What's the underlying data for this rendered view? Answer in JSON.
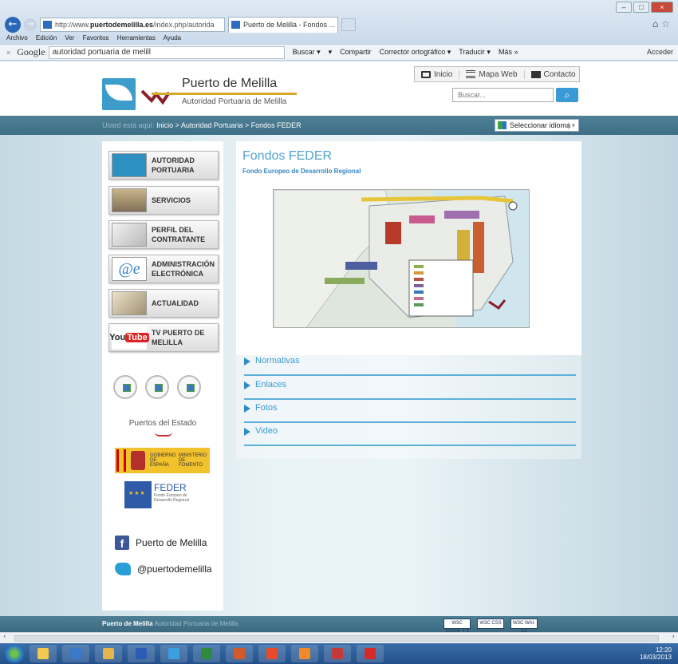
{
  "browser": {
    "address_prefix": "http://www.",
    "address_domain": "puertodemelilla.es",
    "address_path": "/index.php/autorida",
    "tab_title": "Puerto de Melilla - Fondos ...",
    "menu": [
      "Archivo",
      "Edición",
      "Ver",
      "Favoritos",
      "Herramientas",
      "Ayuda"
    ]
  },
  "google_bar": {
    "close": "×",
    "logo": "Google",
    "query": "autoridad portuaria de melill",
    "items": [
      "Buscar ▾",
      "▾",
      "Compartir",
      "Corrector ortográfico ▾",
      "Traducir ▾",
      "Más »"
    ],
    "acceder": "Acceder"
  },
  "site": {
    "logo_title": "Puerto de Melilla",
    "logo_subtitle": "Autoridad Portuaria de Melilla",
    "topnav": [
      "Inicio",
      "Mapa Web",
      "Contacto"
    ],
    "search_placeholder": "Buscar...",
    "breadcrumb_label": "Usted está aquí:",
    "breadcrumb": "Inicio  >  Autoridad Portuaria  >  Fondos FEDER",
    "language": "Seleccionar idioma"
  },
  "sidebar": {
    "items": [
      {
        "label1": "AUTORIDAD",
        "label2": "PORTUARIA"
      },
      {
        "label1": "SERVICIOS",
        "label2": ""
      },
      {
        "label1": "PERFIL DEL",
        "label2": "CONTRATANTE"
      },
      {
        "label1": "ADMINISTRACIÓN",
        "label2": "ELECTRÓNICA"
      },
      {
        "label1": "ACTUALIDAD",
        "label2": ""
      },
      {
        "label1": "TV PUERTO DE",
        "label2": "MELILLA"
      }
    ],
    "puertos_estado": "Puertos del Estado",
    "gobierno": "GOBIERNO DE ESPAÑA",
    "ministerio": "MINISTERIO DE FOMENTO",
    "feder": "FEDER",
    "feder_sub": "Fondo Europeo de Desarrollo Regional",
    "facebook": "Puerto de Melilla",
    "twitter": "@puertodemelilla"
  },
  "content": {
    "title": "Fondos FEDER",
    "subtitle": "Fondo Europeo de Desarrollo Regional",
    "accordion": [
      "Normativas",
      "Enlaces",
      "Fotos",
      "Video"
    ]
  },
  "footer": {
    "name": "Puerto de Melilla",
    "sub": "Autoridad Portuaria de Melilla",
    "badges": [
      "W3C XHTML 1.0",
      "W3C CSS",
      "W3C WAI-AA"
    ]
  },
  "taskbar": {
    "time": "12:20",
    "date": "18/03/2013"
  },
  "colors": {
    "accent": "#3d9bd0",
    "bar": "#456f84"
  }
}
